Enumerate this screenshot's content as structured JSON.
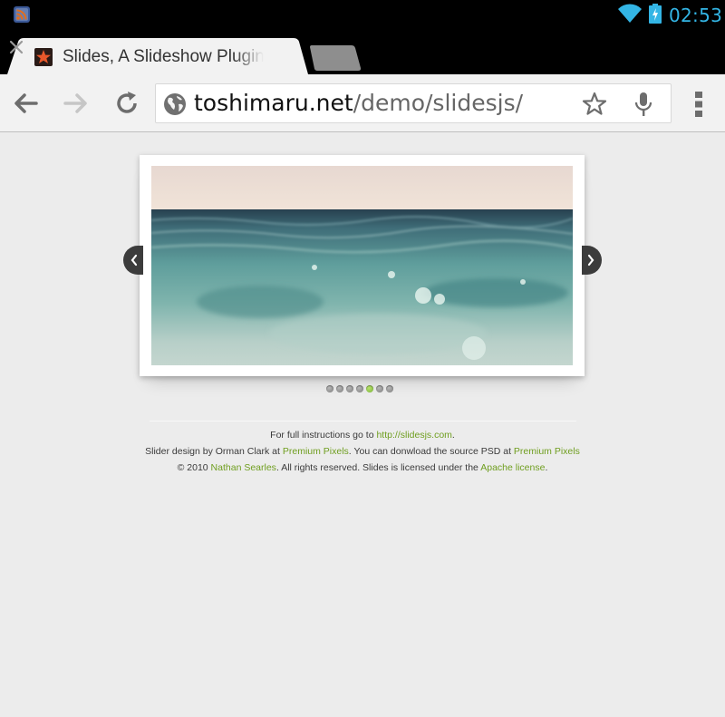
{
  "status_bar": {
    "time": "02:53",
    "time_color": "#33b5e5",
    "icons": [
      "rss-icon",
      "wifi-icon",
      "battery-charging-icon"
    ]
  },
  "tabs": {
    "active": {
      "title": "Slides, A Slideshow Plugin for jQuery",
      "favicon": "star-favicon-icon"
    },
    "new_tab_icon": "new-tab-icon"
  },
  "toolbar": {
    "url_host": "toshimaru.net",
    "url_path": "/demo/slidesjs/",
    "icons": [
      "back-icon",
      "forward-icon",
      "reload-icon",
      "globe-icon",
      "bookmark-star-icon",
      "microphone-icon",
      "overflow-menu-icon"
    ]
  },
  "slideshow": {
    "slide_count": 7,
    "active_slide": 5,
    "accent_color": "#8bc43f",
    "prev_icon": "chevron-left-icon",
    "next_icon": "chevron-right-icon"
  },
  "footer": {
    "line1_text": "For full instructions go to ",
    "line1_link": "http://slidesjs.com",
    "line1_end": ".",
    "line2_text": "Slider design by Orman Clark at ",
    "line2_link1": "Premium Pixels",
    "line2_mid": ". You can donwload the source PSD at ",
    "line2_link2": "Premium Pixels",
    "line3_start": "© 2010 ",
    "line3_link1": "Nathan Searles",
    "line3_mid": ". All rights reserved. Slides is licensed under the ",
    "line3_link2": "Apache license",
    "line3_end": ".",
    "link_color": "#6f9e1f"
  }
}
